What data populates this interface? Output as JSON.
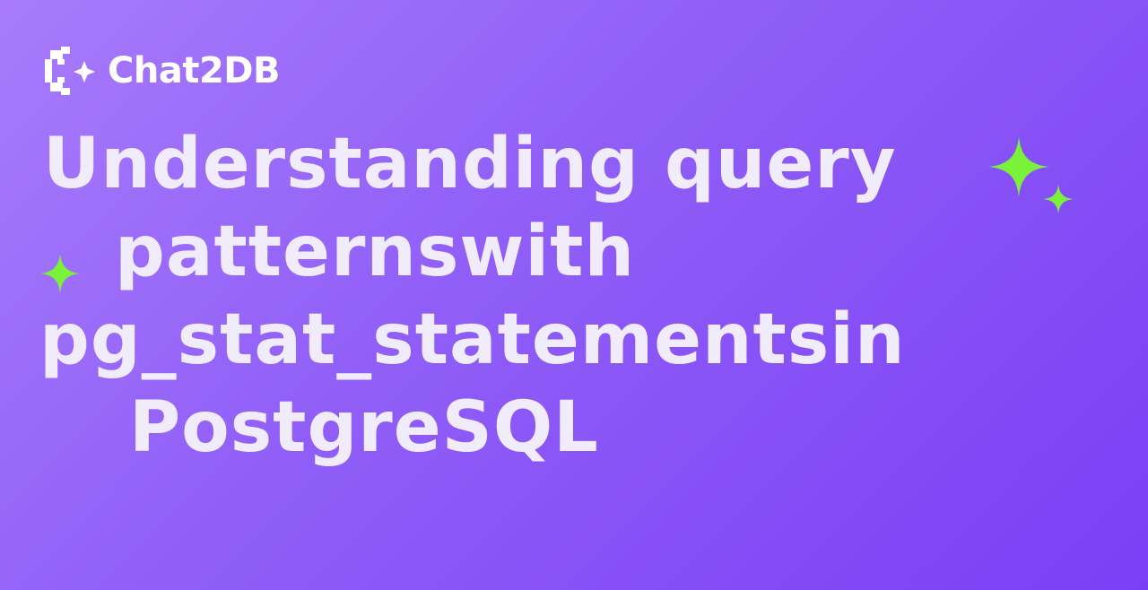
{
  "brand": {
    "name": "Chat2DB",
    "logo_icon": "chat2db-logo-icon"
  },
  "headline": {
    "lines": [
      "Understanding query",
      "patternswith",
      "pg_stat_statementsin",
      "PostgreSQL"
    ]
  },
  "decorations": {
    "sparkle_color": "#7bf23a",
    "icons": [
      "sparkle-icon",
      "sparkle-icon",
      "sparkle-icon"
    ]
  },
  "colors": {
    "background_start": "#a87bfb",
    "background_end": "#7a3ff5",
    "text": "#f1ecfb",
    "accent": "#7bf23a"
  }
}
